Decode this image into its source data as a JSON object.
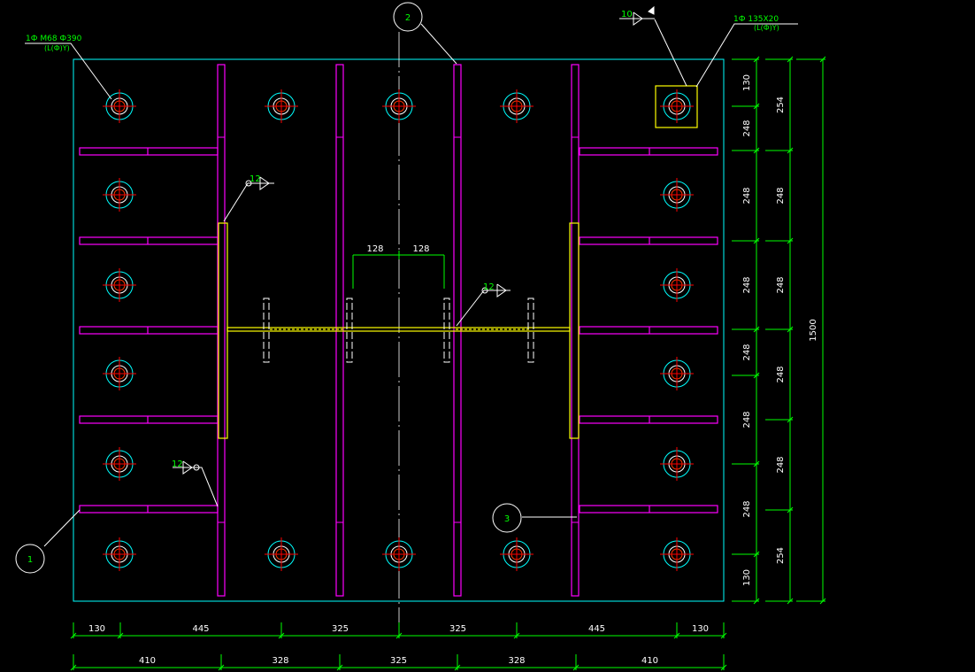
{
  "callouts": {
    "c1": "1",
    "c2": "2",
    "c3": "3"
  },
  "labels": {
    "anchor_top": "1Ф M68 Ф390",
    "anchor_bottom": "(L(Ф)Y)",
    "plate_top": "1Ф 135X20",
    "plate_bottom": "(L(Ф)Y)",
    "weld_top": "10",
    "weld_a": "12",
    "weld_b": "12",
    "weld_c": "12"
  },
  "dims": {
    "center_left": "128",
    "center_right": "128",
    "bottom_row1": [
      "130",
      "445",
      "325",
      "325",
      "445",
      "130"
    ],
    "bottom_row2": [
      "410",
      "328",
      "325",
      "328",
      "410"
    ],
    "right_col1": [
      "130",
      "248",
      "248",
      "248",
      "248",
      "248",
      "248",
      "130"
    ],
    "right_col2": [
      "254",
      "248",
      "248",
      "248",
      "248",
      "254"
    ],
    "right_total": "1500"
  },
  "colors": {
    "plate": "#00ffff",
    "stiffener": "#ff00ff",
    "column": "#ffff00",
    "bolt_outer": "#00ffff",
    "bolt_inner": "#ff0000",
    "dim": "#00ff00",
    "axis": "#ffffff"
  }
}
